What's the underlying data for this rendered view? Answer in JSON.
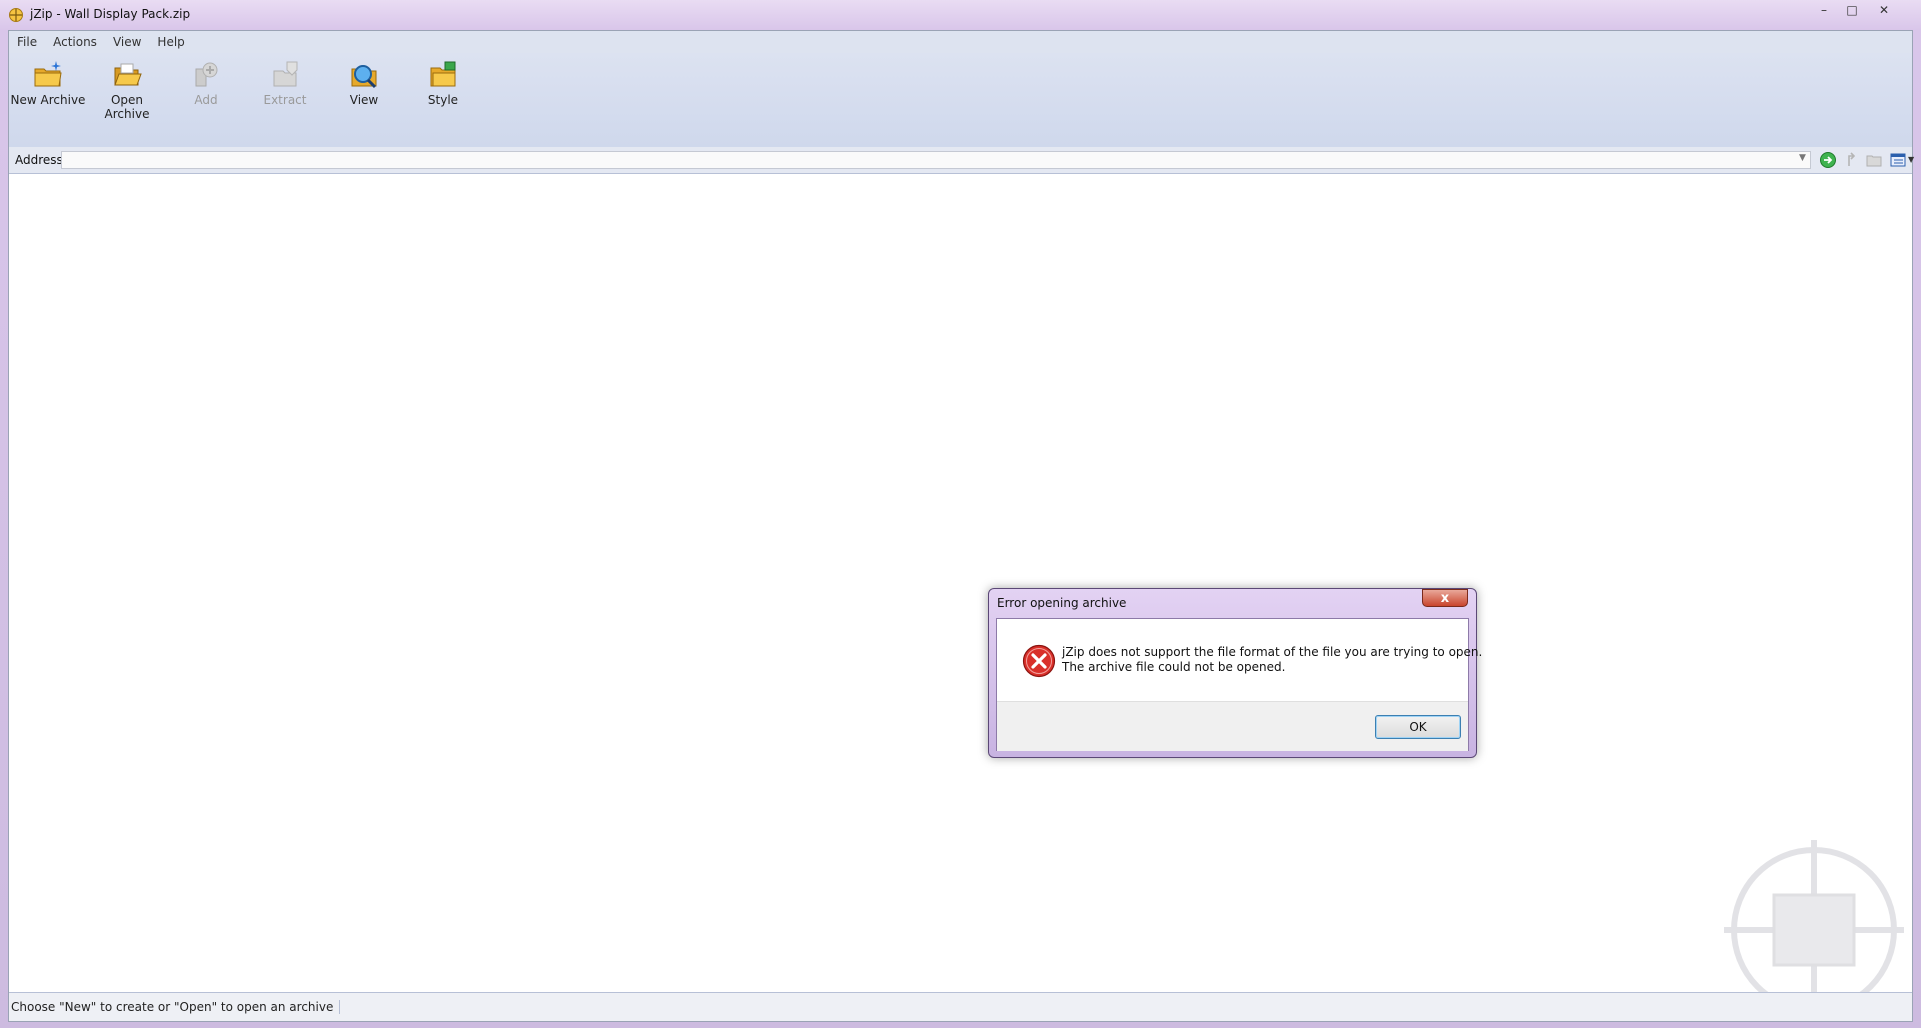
{
  "window": {
    "title": "jZip - Wall Display Pack.zip"
  },
  "menu": {
    "items": [
      "File",
      "Actions",
      "View",
      "Help"
    ]
  },
  "toolbar": {
    "new_archive": "New Archive",
    "open_archive": "Open Archive",
    "add": "Add",
    "extract": "Extract",
    "view": "View",
    "style": "Style"
  },
  "address": {
    "label": "Address",
    "value": ""
  },
  "status": {
    "text": "Choose \"New\" to create or \"Open\" to open an archive"
  },
  "dialog": {
    "title": "Error opening archive",
    "message_line1": "jZip does not support the file format of the file you are trying to open.",
    "message_line2": "The archive file could not be opened.",
    "ok_label": "OK",
    "close_glyph": "x"
  },
  "colors": {
    "accent": "#3c7fb1",
    "error_red": "#d9302a",
    "titlebar": "#e0d0ef",
    "toolbar": "#d4dcef"
  },
  "icons": [
    "jzip-app-icon",
    "new-archive-icon",
    "open-archive-icon",
    "add-icon",
    "extract-icon",
    "view-icon",
    "style-icon",
    "go-icon",
    "error-icon"
  ]
}
